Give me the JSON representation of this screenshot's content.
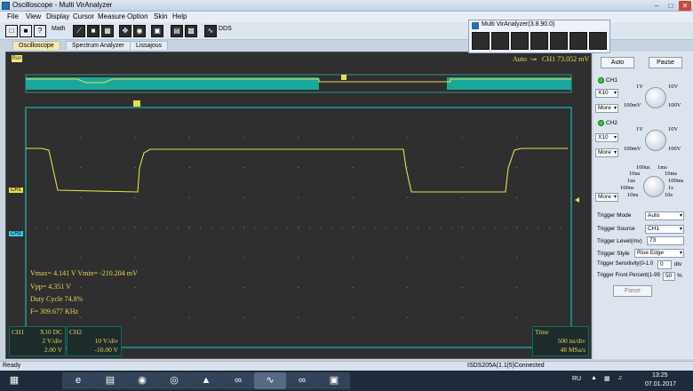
{
  "window": {
    "title": "Oscilloscope - Multi VirAnalyzer"
  },
  "menu": [
    "File",
    "View",
    "Display",
    "Cursor",
    "Measure",
    "Option",
    "Skin",
    "Help"
  ],
  "toolbar": {
    "math_label": "Math",
    "dds_label": "DDS"
  },
  "mva": {
    "title": "Multi VirAnalyzer(3.8.90.0)"
  },
  "tabs": [
    "Oscilloscope",
    "Spectrum Analyzer",
    "Lissajous"
  ],
  "scope": {
    "trigger_status": "Auto",
    "trigger_readout": "CH1 73.052 mV",
    "ch1_marker": "CH1",
    "ch2_marker": "CH2",
    "trigger_marker": "T",
    "run_badge": "Run",
    "measurements": {
      "vmax_vmin": "Vmax= 4.141 V  Vmin= -210.204 mV",
      "vpp": "Vpp= 4.351 V",
      "duty": "Duty Cycle 74.8%",
      "freq": "F= 309.677 KHz"
    }
  },
  "info": {
    "ch1": {
      "name": "CH1",
      "probe": "X10  DC",
      "vdiv": "2 V/div",
      "offset": "2.00 V"
    },
    "ch2": {
      "name": "CH2",
      "vdiv": "10 V/div",
      "offset": "-10.00 V"
    },
    "time": {
      "name": "Time",
      "tdiv": "500 ns/div",
      "rate": "48 MSa/s"
    }
  },
  "panel": {
    "auto_btn": "Auto",
    "pause_btn": "Pause",
    "ch1": {
      "label": "CH1",
      "probe": "X10",
      "more": "More",
      "knob": [
        "1V",
        "10V",
        "100mV",
        "100V"
      ]
    },
    "ch2": {
      "label": "CH2",
      "probe": "X10",
      "more": "More",
      "knob": [
        "1V",
        "10V",
        "100mV",
        "100V"
      ]
    },
    "time_more": "More",
    "time_knob": [
      "100us",
      "1ms",
      "10us",
      "10ms",
      "1us",
      "100ms",
      "100ns",
      "1s",
      "10ns",
      "10s"
    ],
    "trigger": {
      "mode_label": "Trigger Mode",
      "mode": "Auto",
      "source_label": "Trigger Source",
      "source": "CH1",
      "level_label": "Trigger Level(mv)",
      "level": "73",
      "style_label": "Trigger Style",
      "style": "Rise Edge",
      "sens_label": "Trigger Sensitivity(0-1.0",
      "sens": "0",
      "sens_unit": "div",
      "front_label": "Trigger Front Percent(1-99",
      "front": "50",
      "front_unit": "%",
      "force": "Force"
    }
  },
  "status": {
    "ready": "Ready",
    "device": "ISDS205A(1.1|5)Connected"
  },
  "taskbar": {
    "lang": "RU",
    "time": "13:25",
    "date": "07.01.2017"
  },
  "colors": {
    "trace": "#e6dd55",
    "grid_border": "#19a79c",
    "overview": "#1aa89a"
  }
}
